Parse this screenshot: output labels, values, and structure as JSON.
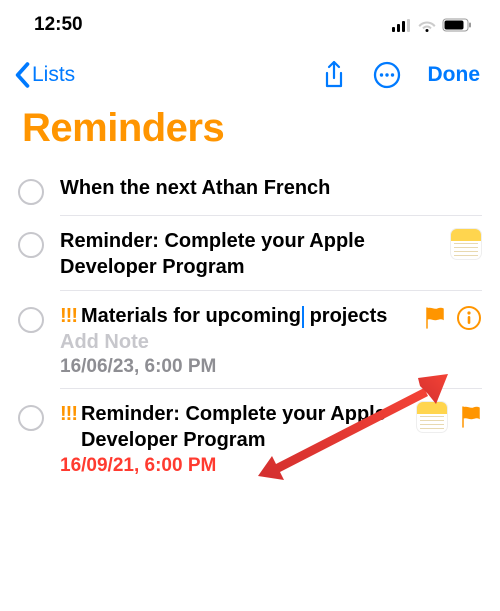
{
  "status_bar": {
    "time": "12:50"
  },
  "nav": {
    "back_label": "Lists",
    "done_label": "Done"
  },
  "page": {
    "title": "Reminders"
  },
  "reminders": [
    {
      "priority": "",
      "title": "When the next Athan French",
      "add_note": "",
      "date": "",
      "overdue": false,
      "has_notes_attachment": false,
      "flagged": false,
      "editing": false,
      "show_info": false
    },
    {
      "priority": "",
      "title": "Reminder: Complete your Apple Developer Program",
      "add_note": "",
      "date": "",
      "overdue": false,
      "has_notes_attachment": true,
      "flagged": false,
      "editing": false,
      "show_info": false
    },
    {
      "priority": "!!!",
      "title": "Materials for upcoming projects",
      "add_note": "Add Note",
      "date": "16/06/23, 6:00 PM",
      "overdue": false,
      "has_notes_attachment": false,
      "flagged": true,
      "editing": true,
      "show_info": true
    },
    {
      "priority": "!!!",
      "title": "Reminder: Complete your Apple Developer Program",
      "add_note": "",
      "date": "16/09/21, 6:00 PM",
      "overdue": true,
      "has_notes_attachment": true,
      "flagged": true,
      "editing": false,
      "show_info": false
    }
  ]
}
